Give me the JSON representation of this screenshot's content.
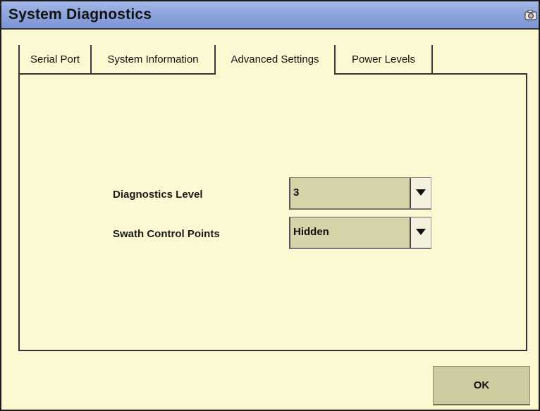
{
  "window": {
    "title": "System Diagnostics"
  },
  "tabs": [
    {
      "label": "Serial Port",
      "active": false
    },
    {
      "label": "System Information",
      "active": false
    },
    {
      "label": "Advanced Settings",
      "active": true
    },
    {
      "label": "Power Levels",
      "active": false
    }
  ],
  "fields": {
    "diagnostics_level": {
      "label": "Diagnostics Level",
      "value": "3"
    },
    "swath_control_points": {
      "label": "Swath Control Points",
      "value": "Hidden"
    }
  },
  "buttons": {
    "ok_label": "OK"
  },
  "icons": {
    "screenshot": "camera-icon",
    "dropdown": "triangle-down-icon"
  },
  "colors": {
    "background": "#fbf8d2",
    "titlebar": "#8aa3dc",
    "control": "#d6d3a8"
  }
}
